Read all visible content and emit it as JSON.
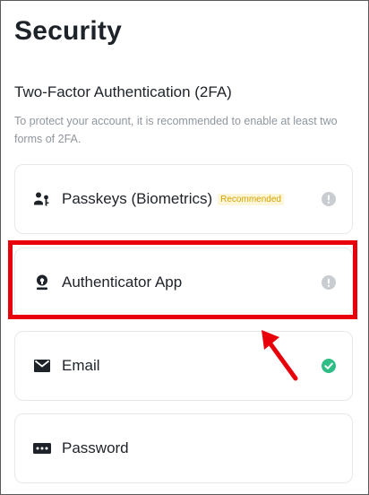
{
  "page": {
    "title": "Security",
    "section_title": "Two-Factor Authentication (2FA)",
    "section_desc": "To protect your account, it is recommended to enable at least two forms of 2FA."
  },
  "methods": [
    {
      "label": "Passkeys (Biometrics)",
      "badge": "Recommended",
      "icon": "passkey-icon",
      "status": "warning"
    },
    {
      "label": "Authenticator App",
      "icon": "authenticator-icon",
      "status": "warning"
    },
    {
      "label": "Email",
      "icon": "envelope-icon",
      "status": "enabled"
    },
    {
      "label": "Password",
      "icon": "password-icon",
      "status": "none"
    }
  ],
  "colors": {
    "highlight": "#e8000b",
    "badge_text": "#d4a300",
    "badge_bg": "#fdf6d8",
    "enabled": "#2ebd85",
    "warning": "#c9ccd1"
  }
}
